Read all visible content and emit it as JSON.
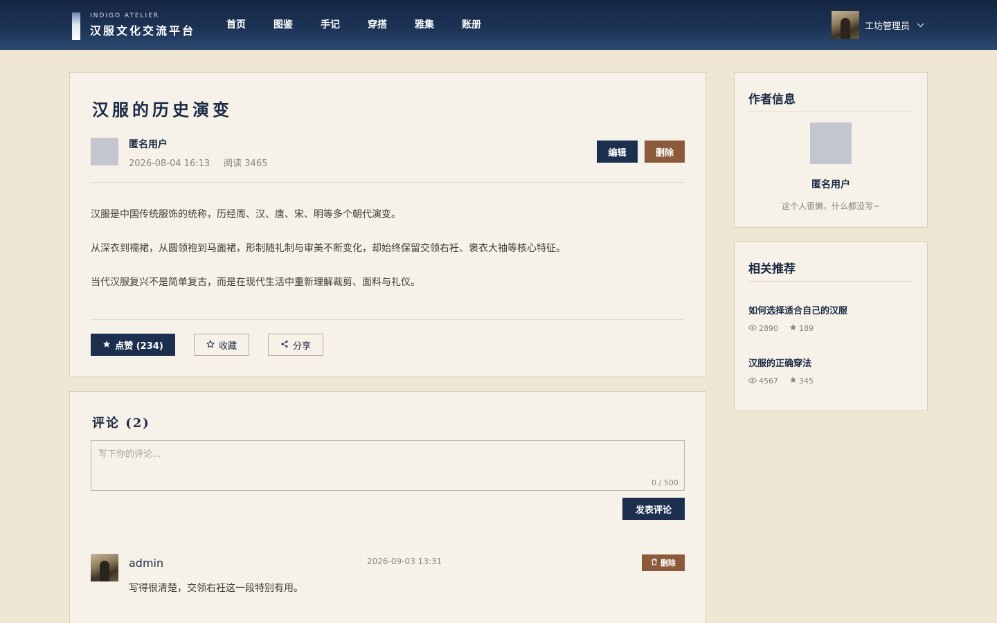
{
  "brand": {
    "subtitle": "INDIGO ATELIER",
    "title": "汉服文化交流平台"
  },
  "nav": {
    "items": [
      "首页",
      "图鉴",
      "手记",
      "穿搭",
      "雅集",
      "账册"
    ]
  },
  "user": {
    "name": "工坊管理员"
  },
  "article": {
    "title": "汉服的历史演变",
    "author": "匿名用户",
    "date": "2026-08-04 16:13",
    "reads": "阅读 3465",
    "edit_label": "编辑",
    "delete_label": "删除",
    "paragraphs": [
      "汉服是中国传统服饰的统称，历经周、汉、唐、宋、明等多个朝代演变。",
      "从深衣到襦裙，从圆领袍到马面裙，形制随礼制与审美不断变化，却始终保留交领右衽、褒衣大袖等核心特征。",
      "当代汉服复兴不是简单复古，而是在现代生活中重新理解裁剪、面料与礼仪。"
    ],
    "like_label": "点赞 (234)",
    "fav_label": "收藏",
    "share_label": "分享"
  },
  "comments": {
    "title": "评论 (2)",
    "placeholder": "写下你的评论...",
    "count": "0 / 500",
    "post_label": "发表评论",
    "items": [
      {
        "user": "admin",
        "time": "2026-09-03 13:31",
        "text": "写得很清楚，交领右衽这一段特别有用。",
        "delete_label": "删除"
      }
    ]
  },
  "author_card": {
    "title": "作者信息",
    "name": "匿名用户",
    "bio": "这个人很懒，什么都没写~"
  },
  "related": {
    "title": "相关推荐",
    "items": [
      {
        "title": "如何选择适合自己的汉服",
        "views": "2890",
        "stars": "189"
      },
      {
        "title": "汉服的正确穿法",
        "views": "4567",
        "stars": "345"
      }
    ]
  },
  "colors": {
    "navy": "#1c2f4f",
    "brown": "#8a5a3a",
    "page_bg": "#efe6d4",
    "card_bg": "#f7f2e9"
  }
}
